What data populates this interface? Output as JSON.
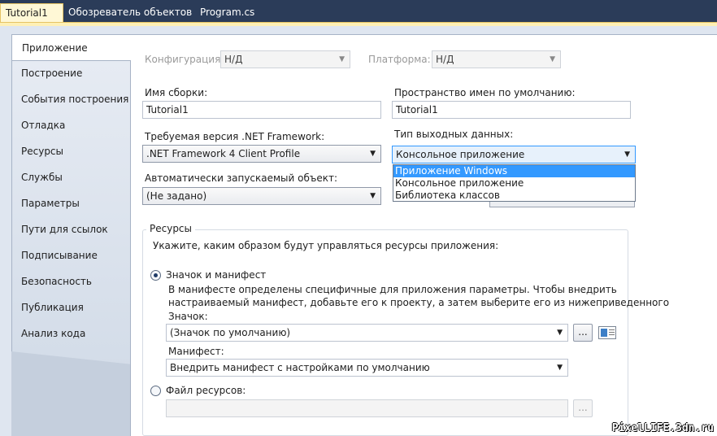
{
  "tabs": [
    {
      "label": "Tutorial1",
      "close": "✕"
    },
    {
      "label": "Обозреватель объектов"
    },
    {
      "label": "Program.cs"
    }
  ],
  "nav": {
    "items": [
      "Приложение",
      "Построение",
      "События построения",
      "Отладка",
      "Ресурсы",
      "Службы",
      "Параметры",
      "Пути для ссылок",
      "Подписывание",
      "Безопасность",
      "Публикация",
      "Анализ кода"
    ]
  },
  "config": {
    "config_label": "Конфигурация:",
    "config_value": "Н/Д",
    "platform_label": "Платформа:",
    "platform_value": "Н/Д"
  },
  "assembly": {
    "label": "Имя сборки:",
    "value": "Tutorial1"
  },
  "namespace": {
    "label": "Пространство имен по умолчанию:",
    "value": "Tutorial1"
  },
  "framework": {
    "label": "Требуемая версия .NET Framework:",
    "value": ".NET Framework 4 Client Profile"
  },
  "output": {
    "label": "Тип выходных данных:",
    "value": "Консольное приложение",
    "options": [
      "Приложение Windows",
      "Консольное приложение",
      "Библиотека классов"
    ]
  },
  "startup": {
    "label": "Автоматически запускаемый объект:",
    "value": "(Не задано)"
  },
  "resources": {
    "title": "Ресурсы",
    "description": "Укажите, каким образом будут управляться ресурсы приложения:",
    "radio_icon": "Значок и манифест",
    "manifest_text_1": "В манифесте определены специфичные для приложения параметры. Чтобы внедрить",
    "manifest_text_2": "настраиваемый манифест, добавьте его к проекту, а затем выберите его из нижеприведенного",
    "icon_label": "Значок:",
    "icon_value": "(Значок по умолчанию)",
    "manifest_label": "Манифест:",
    "manifest_value": "Внедрить манифест с настройками по умолчанию",
    "radio_file": "Файл ресурсов:",
    "file_value": "",
    "browse": "..."
  },
  "arrow": "▼",
  "watermark": "PixelLIFE.3dn.ru"
}
